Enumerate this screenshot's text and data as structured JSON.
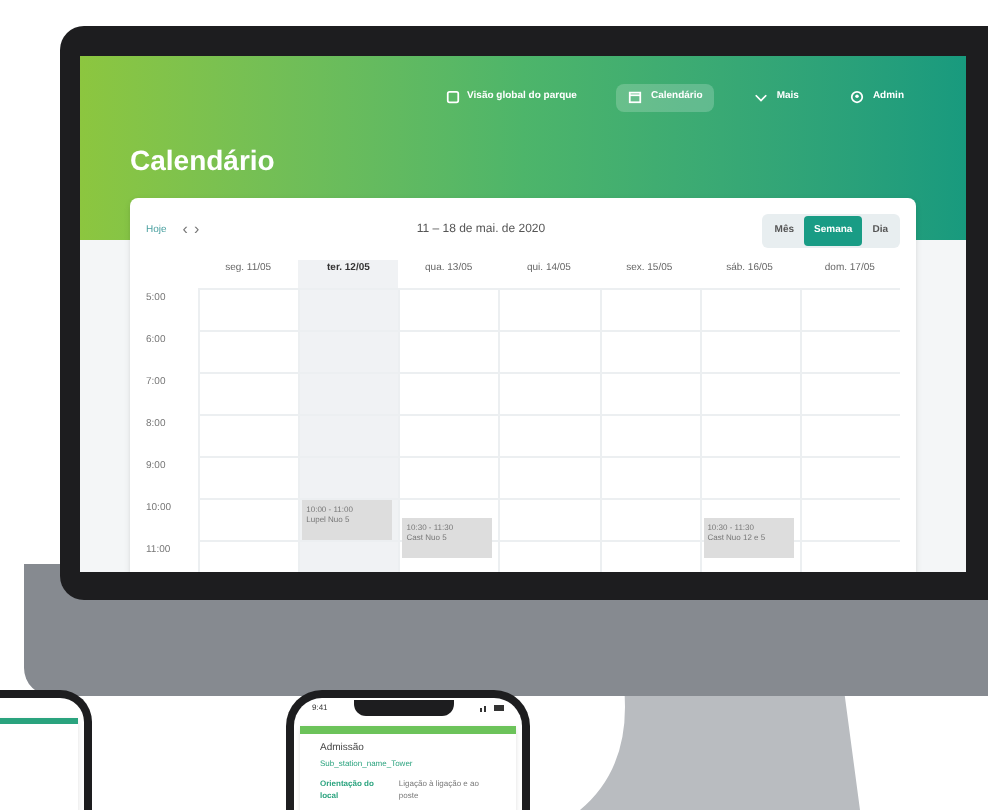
{
  "nav": [
    {
      "label": "Visão global do parque",
      "selected": false
    },
    {
      "label": "Calendário",
      "selected": true
    },
    {
      "label": "Mais",
      "selected": false
    },
    {
      "label": "Admin",
      "selected": false
    }
  ],
  "title": "Calendário",
  "toolbar": {
    "today": "Hoje",
    "prev": "‹",
    "next": "›",
    "range": "11 – 18 de mai. de 2020"
  },
  "views": [
    {
      "label": "Mês",
      "selected": false
    },
    {
      "label": "Semana",
      "selected": true
    },
    {
      "label": "Dia",
      "selected": false
    }
  ],
  "days": [
    {
      "label": "seg. 11/05",
      "selected": false
    },
    {
      "label": "ter. 12/05",
      "selected": true
    },
    {
      "label": "qua. 13/05",
      "selected": false
    },
    {
      "label": "qui. 14/05",
      "selected": false
    },
    {
      "label": "sex. 15/05",
      "selected": false
    },
    {
      "label": "sáb. 16/05",
      "selected": false
    },
    {
      "label": "dom. 17/05",
      "selected": false
    }
  ],
  "rows": [
    {
      "time": "5:00",
      "cells": [
        null,
        null,
        null,
        null,
        null,
        null,
        null
      ]
    },
    {
      "time": "6:00",
      "cells": [
        null,
        null,
        null,
        null,
        null,
        null,
        null
      ]
    },
    {
      "time": "7:00",
      "cells": [
        null,
        null,
        null,
        null,
        null,
        null,
        null
      ]
    },
    {
      "time": "8:00",
      "cells": [
        null,
        null,
        null,
        null,
        null,
        null,
        null
      ]
    },
    {
      "time": "9:00",
      "cells": [
        null,
        null,
        null,
        null,
        null,
        null,
        null
      ]
    },
    {
      "time": "10:00",
      "cells": [
        null,
        {
          "kind": "on-hour",
          "time": "10:00 - 11:00",
          "title": "Lupel Nuo 5"
        },
        {
          "kind": "half-hour",
          "time": "10:30 - 11:30",
          "title": "Cast Nuo 5"
        },
        null,
        null,
        {
          "kind": "half-hour",
          "time": "10:30 - 11:30",
          "title": "Cast Nuo 12 e 5"
        },
        null
      ]
    },
    {
      "time": "11:00",
      "cells": [
        null,
        null,
        null,
        null,
        null,
        null,
        null
      ]
    }
  ],
  "phone": {
    "time": "9:41",
    "title": "Admissão",
    "subtitle": "Sub_station_name_Tower",
    "field_label": "Orientação do local",
    "field_value": "Ligação à ligação e ao poste"
  }
}
